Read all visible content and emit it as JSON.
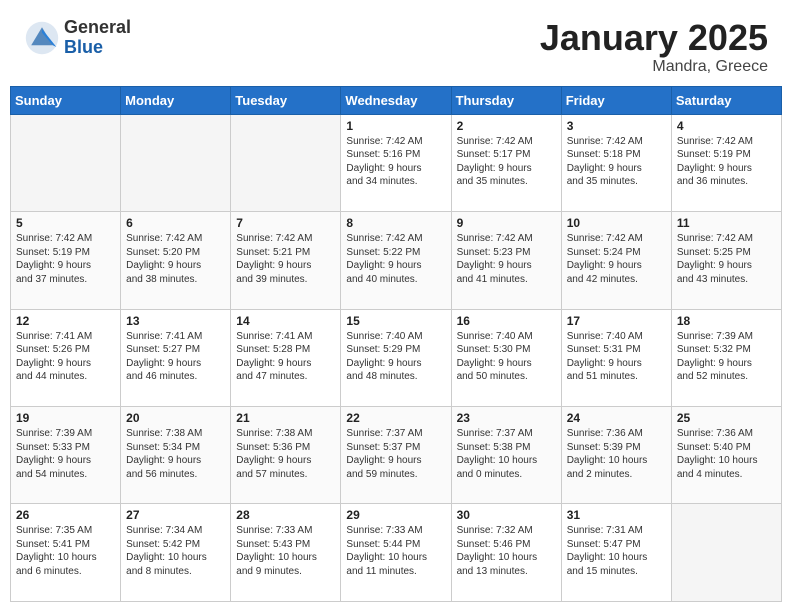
{
  "header": {
    "logo_general": "General",
    "logo_blue": "Blue",
    "month_title": "January 2025",
    "location": "Mandra, Greece"
  },
  "weekdays": [
    "Sunday",
    "Monday",
    "Tuesday",
    "Wednesday",
    "Thursday",
    "Friday",
    "Saturday"
  ],
  "weeks": [
    [
      {
        "day": "",
        "info": ""
      },
      {
        "day": "",
        "info": ""
      },
      {
        "day": "",
        "info": ""
      },
      {
        "day": "1",
        "info": "Sunrise: 7:42 AM\nSunset: 5:16 PM\nDaylight: 9 hours\nand 34 minutes."
      },
      {
        "day": "2",
        "info": "Sunrise: 7:42 AM\nSunset: 5:17 PM\nDaylight: 9 hours\nand 35 minutes."
      },
      {
        "day": "3",
        "info": "Sunrise: 7:42 AM\nSunset: 5:18 PM\nDaylight: 9 hours\nand 35 minutes."
      },
      {
        "day": "4",
        "info": "Sunrise: 7:42 AM\nSunset: 5:19 PM\nDaylight: 9 hours\nand 36 minutes."
      }
    ],
    [
      {
        "day": "5",
        "info": "Sunrise: 7:42 AM\nSunset: 5:19 PM\nDaylight: 9 hours\nand 37 minutes."
      },
      {
        "day": "6",
        "info": "Sunrise: 7:42 AM\nSunset: 5:20 PM\nDaylight: 9 hours\nand 38 minutes."
      },
      {
        "day": "7",
        "info": "Sunrise: 7:42 AM\nSunset: 5:21 PM\nDaylight: 9 hours\nand 39 minutes."
      },
      {
        "day": "8",
        "info": "Sunrise: 7:42 AM\nSunset: 5:22 PM\nDaylight: 9 hours\nand 40 minutes."
      },
      {
        "day": "9",
        "info": "Sunrise: 7:42 AM\nSunset: 5:23 PM\nDaylight: 9 hours\nand 41 minutes."
      },
      {
        "day": "10",
        "info": "Sunrise: 7:42 AM\nSunset: 5:24 PM\nDaylight: 9 hours\nand 42 minutes."
      },
      {
        "day": "11",
        "info": "Sunrise: 7:42 AM\nSunset: 5:25 PM\nDaylight: 9 hours\nand 43 minutes."
      }
    ],
    [
      {
        "day": "12",
        "info": "Sunrise: 7:41 AM\nSunset: 5:26 PM\nDaylight: 9 hours\nand 44 minutes."
      },
      {
        "day": "13",
        "info": "Sunrise: 7:41 AM\nSunset: 5:27 PM\nDaylight: 9 hours\nand 46 minutes."
      },
      {
        "day": "14",
        "info": "Sunrise: 7:41 AM\nSunset: 5:28 PM\nDaylight: 9 hours\nand 47 minutes."
      },
      {
        "day": "15",
        "info": "Sunrise: 7:40 AM\nSunset: 5:29 PM\nDaylight: 9 hours\nand 48 minutes."
      },
      {
        "day": "16",
        "info": "Sunrise: 7:40 AM\nSunset: 5:30 PM\nDaylight: 9 hours\nand 50 minutes."
      },
      {
        "day": "17",
        "info": "Sunrise: 7:40 AM\nSunset: 5:31 PM\nDaylight: 9 hours\nand 51 minutes."
      },
      {
        "day": "18",
        "info": "Sunrise: 7:39 AM\nSunset: 5:32 PM\nDaylight: 9 hours\nand 52 minutes."
      }
    ],
    [
      {
        "day": "19",
        "info": "Sunrise: 7:39 AM\nSunset: 5:33 PM\nDaylight: 9 hours\nand 54 minutes."
      },
      {
        "day": "20",
        "info": "Sunrise: 7:38 AM\nSunset: 5:34 PM\nDaylight: 9 hours\nand 56 minutes."
      },
      {
        "day": "21",
        "info": "Sunrise: 7:38 AM\nSunset: 5:36 PM\nDaylight: 9 hours\nand 57 minutes."
      },
      {
        "day": "22",
        "info": "Sunrise: 7:37 AM\nSunset: 5:37 PM\nDaylight: 9 hours\nand 59 minutes."
      },
      {
        "day": "23",
        "info": "Sunrise: 7:37 AM\nSunset: 5:38 PM\nDaylight: 10 hours\nand 0 minutes."
      },
      {
        "day": "24",
        "info": "Sunrise: 7:36 AM\nSunset: 5:39 PM\nDaylight: 10 hours\nand 2 minutes."
      },
      {
        "day": "25",
        "info": "Sunrise: 7:36 AM\nSunset: 5:40 PM\nDaylight: 10 hours\nand 4 minutes."
      }
    ],
    [
      {
        "day": "26",
        "info": "Sunrise: 7:35 AM\nSunset: 5:41 PM\nDaylight: 10 hours\nand 6 minutes."
      },
      {
        "day": "27",
        "info": "Sunrise: 7:34 AM\nSunset: 5:42 PM\nDaylight: 10 hours\nand 8 minutes."
      },
      {
        "day": "28",
        "info": "Sunrise: 7:33 AM\nSunset: 5:43 PM\nDaylight: 10 hours\nand 9 minutes."
      },
      {
        "day": "29",
        "info": "Sunrise: 7:33 AM\nSunset: 5:44 PM\nDaylight: 10 hours\nand 11 minutes."
      },
      {
        "day": "30",
        "info": "Sunrise: 7:32 AM\nSunset: 5:46 PM\nDaylight: 10 hours\nand 13 minutes."
      },
      {
        "day": "31",
        "info": "Sunrise: 7:31 AM\nSunset: 5:47 PM\nDaylight: 10 hours\nand 15 minutes."
      },
      {
        "day": "",
        "info": ""
      }
    ]
  ]
}
